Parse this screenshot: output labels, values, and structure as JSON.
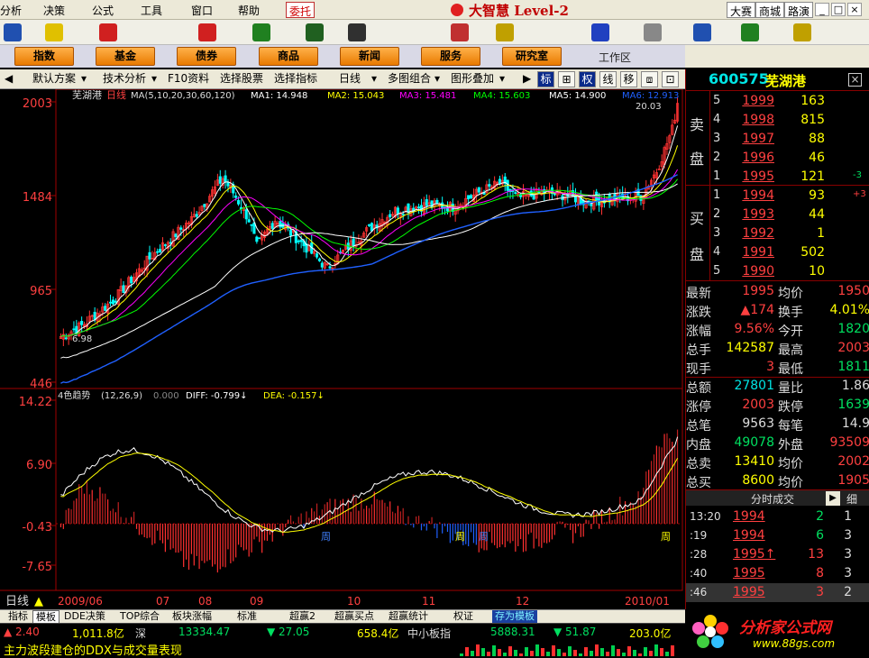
{
  "menu": {
    "items": [
      "分析",
      "决策",
      "公式",
      "工具",
      "窗口",
      "帮助"
    ],
    "weituo": "委托",
    "brand": "大智慧 Level-2",
    "links": [
      "大赛",
      "商城",
      "路演"
    ],
    "window_controls": [
      "_",
      "□",
      "×"
    ]
  },
  "toolbar_icons": [
    "si-icon",
    "calculator-icon",
    "move-icon",
    "dollar-icon",
    "glasses-icon",
    "bar-chart-icon",
    "binoculars-icon",
    "arrows-icon",
    "diamond-icon",
    "swirl-icon",
    "printer-icon",
    "monitor-icon",
    "books-icon",
    "help-cursor-icon"
  ],
  "nav": {
    "buttons": [
      "指数",
      "基金",
      "债券",
      "商品",
      "新闻",
      "服务",
      "研究室"
    ],
    "work_area": "工作区"
  },
  "chart_toolbar": {
    "items": [
      "默认方案",
      "技术分析",
      "F10资料",
      "选择股票",
      "选择指标",
      "日线",
      "多图组合",
      "图形叠加"
    ],
    "toggles": [
      "标",
      "⊞",
      "权",
      "线",
      "移",
      "⧈",
      "⊡"
    ]
  },
  "colors": {
    "up": "#ff3232",
    "down": "#00ffff",
    "bg": "#000000",
    "accent": "#ffff00",
    "ma1": "#ffffff",
    "ma2": "#ffff00",
    "ma3": "#ff00ff",
    "ma4": "#00ff00",
    "ma5": "#ffffff",
    "ma6": "#2060ff"
  },
  "chart": {
    "stock_name": "芜湖港",
    "period": "日线",
    "ma_params": "MA(5,10,20,30,60,120)",
    "ma_values": [
      {
        "name": "MA1",
        "text": "MA1: 14.948"
      },
      {
        "name": "MA2",
        "text": "MA2: 15.043"
      },
      {
        "name": "MA3",
        "text": "MA3: 15.481"
      },
      {
        "name": "MA4",
        "text": "MA4: 15.603"
      },
      {
        "name": "MA5",
        "text": "MA5: 14.900"
      },
      {
        "name": "MA6",
        "text": "MA6: 12.913"
      }
    ],
    "max_label": "20.03",
    "min_label": "6.98",
    "y_ticks": [
      "2003",
      "1484",
      "965",
      "446"
    ],
    "indicator": {
      "name": "4色趋势",
      "params": "(12,26,9)",
      "value": "0.000",
      "diff": "DIFF: -0.799↓",
      "dea": "DEA: -0.157↓",
      "y_ticks": [
        "14.22",
        "6.90",
        "-0.43",
        "-7.65"
      ],
      "markers": [
        "周",
        "周",
        "周",
        "周"
      ]
    },
    "x_labels": [
      "2009/06",
      "07",
      "08",
      "09",
      "10",
      "11",
      "12",
      "2010/01"
    ],
    "period_label": "日线"
  },
  "chart_data": {
    "type": "candlestick",
    "y_ticks": [
      2003,
      1484,
      965,
      446
    ],
    "ylim": [
      446,
      2003
    ],
    "x_labels": [
      "2009/06",
      "07",
      "08",
      "09",
      "10",
      "11",
      "12",
      "2010/01"
    ],
    "max_marker": 20.03,
    "min_marker": 6.98,
    "macd": {
      "diff": -0.799,
      "dea": -0.157,
      "y_ticks": [
        14.22,
        6.9,
        -0.43,
        -7.65
      ]
    }
  },
  "quote": {
    "code": "600575",
    "name": "芜湖港",
    "sell_side": "卖盘",
    "buy_side": "买盘",
    "asks": [
      {
        "level": "5",
        "price": "1999",
        "vol": "163"
      },
      {
        "level": "4",
        "price": "1998",
        "vol": "815"
      },
      {
        "level": "3",
        "price": "1997",
        "vol": "88"
      },
      {
        "level": "2",
        "price": "1996",
        "vol": "46"
      },
      {
        "level": "1",
        "price": "1995",
        "vol": "121",
        "extra": "-3"
      }
    ],
    "bids": [
      {
        "level": "1",
        "price": "1994",
        "vol": "93",
        "extra": "+3"
      },
      {
        "level": "2",
        "price": "1993",
        "vol": "44"
      },
      {
        "level": "3",
        "price": "1992",
        "vol": "1"
      },
      {
        "level": "4",
        "price": "1991",
        "vol": "502"
      },
      {
        "level": "5",
        "price": "1990",
        "vol": "10"
      }
    ],
    "stats": [
      {
        "l1": "最新",
        "v1": "1995",
        "c1": "#ff4040",
        "l2": "均价",
        "v2": "1950",
        "c2": "#ff4040"
      },
      {
        "l1": "涨跌",
        "v1": "▲174",
        "c1": "#ff4040",
        "l2": "换手",
        "v2": "4.01%",
        "c2": "#ffff00"
      },
      {
        "l1": "涨幅",
        "v1": "9.56%",
        "c1": "#ff4040",
        "l2": "今开",
        "v2": "1820",
        "c2": "#00e060"
      },
      {
        "l1": "总手",
        "v1": "142587",
        "c1": "#ffff00",
        "l2": "最高",
        "v2": "2003",
        "c2": "#ff4040"
      },
      {
        "l1": "现手",
        "v1": "3",
        "c1": "#ff4040",
        "l2": "最低",
        "v2": "1811",
        "c2": "#00e060"
      },
      {
        "l1": "总额",
        "v1": "27801",
        "c1": "#00e5e5",
        "l2": "量比",
        "v2": "1.86",
        "c2": "#ddd"
      },
      {
        "l1": "涨停",
        "v1": "2003",
        "c1": "#ff4040",
        "l2": "跌停",
        "v2": "1639",
        "c2": "#00e060"
      },
      {
        "l1": "总笔",
        "v1": "9563",
        "c1": "#ddd",
        "l2": "每笔",
        "v2": "14.9",
        "c2": "#ddd"
      },
      {
        "l1": "内盘",
        "v1": "49078",
        "c1": "#00e060",
        "l2": "外盘",
        "v2": "93509",
        "c2": "#ff4040"
      },
      {
        "l1": "总卖",
        "v1": "13410",
        "c1": "#ffff00",
        "l2": "均价",
        "v2": "2002",
        "c2": "#ff4040"
      },
      {
        "l1": "总买",
        "v1": "8600",
        "c1": "#ffff00",
        "l2": "均价",
        "v2": "1905",
        "c2": "#ff4040"
      }
    ],
    "fs_title": "分时成交",
    "fs_fine": "细",
    "trades": [
      {
        "time": "13:20",
        "price": "1994",
        "vol": "2",
        "n": "1",
        "vcolor": "#00e060"
      },
      {
        "time": ":19",
        "price": "1994",
        "vol": "6",
        "n": "3",
        "vcolor": "#00e060"
      },
      {
        "time": ":28",
        "price": "1995↑",
        "vol": "13",
        "n": "3",
        "vcolor": "#ff4040"
      },
      {
        "time": ":40",
        "price": "1995",
        "vol": "8",
        "n": "3",
        "vcolor": "#ff4040"
      },
      {
        "time": ":46",
        "price": "1995",
        "vol": "3",
        "n": "2",
        "vcolor": "#ff4040"
      }
    ]
  },
  "tabs": [
    "指标",
    "模板",
    "DDE决策",
    "TOP综合",
    "板块涨幅",
    "标准",
    "超赢2",
    "超赢买点",
    "超赢统计",
    "权证",
    "存为模板"
  ],
  "status": {
    "sh_change": "▲ 2.40",
    "sh_amount": "1,011.8亿",
    "sz_label": "深",
    "sz_index": "13334.47",
    "sz_change": "▼ 27.05",
    "sz_amount": "658.4亿",
    "sme_label": "中小板指",
    "sme_index": "5888.31",
    "sme_change": "▼ 51.87",
    "sme_amount": "203.0亿"
  },
  "ticker": "主力波段建仓的DDX与成交量表现",
  "logo": {
    "name": "分析家公式网",
    "url": "www.88gs.com"
  }
}
